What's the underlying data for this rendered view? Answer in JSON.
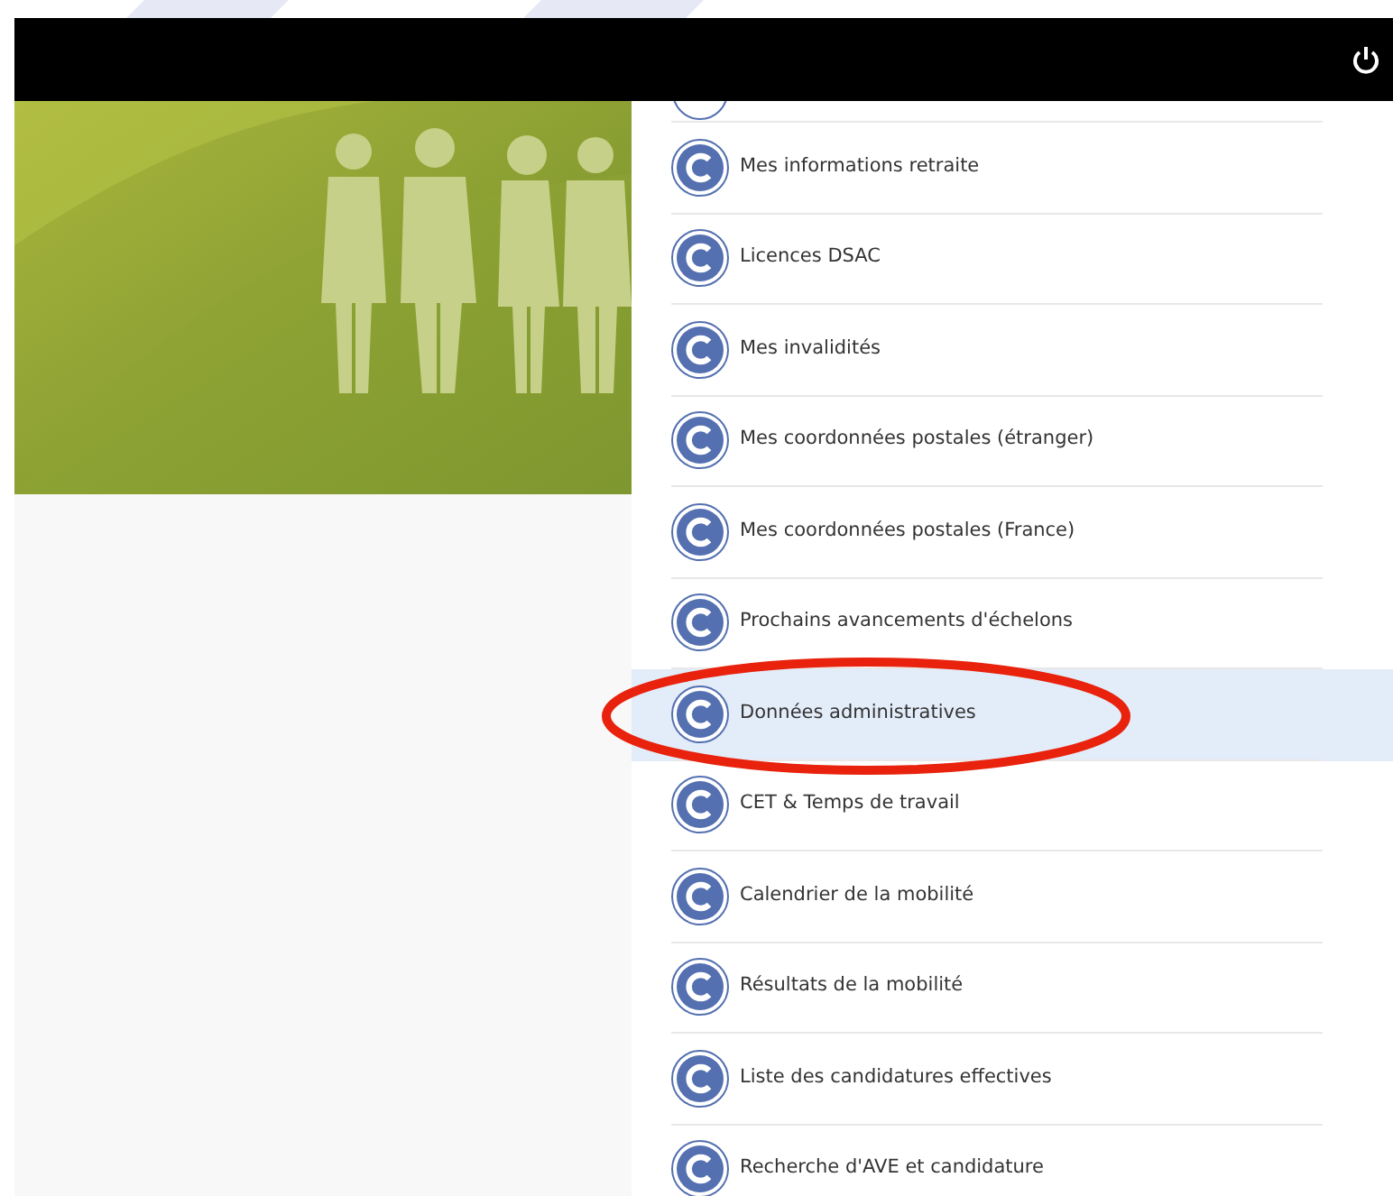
{
  "header": {
    "power_button": true
  },
  "menu": [
    {
      "label": "Mes informations retraite",
      "selected": false,
      "circled": false
    },
    {
      "label": "Licences DSAC",
      "selected": false,
      "circled": false
    },
    {
      "label": "Mes invalidités",
      "selected": false,
      "circled": false
    },
    {
      "label": "Mes coordonnées postales (étranger)",
      "selected": false,
      "circled": false
    },
    {
      "label": "Mes coordonnées postales (France)",
      "selected": false,
      "circled": false
    },
    {
      "label": "Prochains avancements d'échelons",
      "selected": false,
      "circled": false
    },
    {
      "label": "Données administratives",
      "selected": true,
      "circled": true
    },
    {
      "label": "CET & Temps de travail",
      "selected": false,
      "circled": false
    },
    {
      "label": "Calendrier de la mobilité",
      "selected": false,
      "circled": false
    },
    {
      "label": "Résultats de la mobilité",
      "selected": false,
      "circled": false
    },
    {
      "label": "Liste des candidatures effectives",
      "selected": false,
      "circled": false
    },
    {
      "label": "Recherche d'AVE et candidature",
      "selected": false,
      "circled": false
    }
  ]
}
